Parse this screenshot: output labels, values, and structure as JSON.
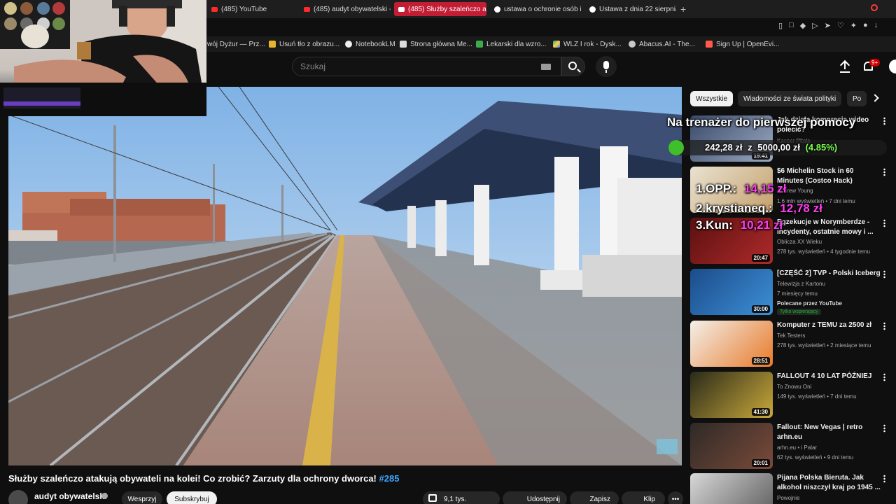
{
  "browser": {
    "tabs": [
      {
        "label": "(485) YouTube",
        "active": false
      },
      {
        "label": "(485) audyt obywatelski -",
        "active": false
      },
      {
        "label": "(485) Służby szaleńczo at",
        "active": true
      },
      {
        "label": "ustawa o ochronie osób i",
        "active": false
      },
      {
        "label": "Ustawa z dnia 22 sierpnia",
        "active": false
      }
    ],
    "new_tab": "+",
    "bookmarks": [
      {
        "label": "wój Dyżur — Prz..."
      },
      {
        "label": "Usuń tło z obrazu..."
      },
      {
        "label": "NotebookLM"
      },
      {
        "label": "Strona główna Me..."
      },
      {
        "label": "Lekarski dla wzro..."
      },
      {
        "label": "WLZ I rok - Dysk..."
      },
      {
        "label": "Abacus.AI - The..."
      },
      {
        "label": "Sign Up | OpenEvi..."
      }
    ]
  },
  "header": {
    "search_placeholder": "Szukaj",
    "notification_count": "9+"
  },
  "video": {
    "title": "Służby szaleńczo atakują obywateli na kolei! Co zrobić? Zarzuty dla ochrony dworca!",
    "hashtag": "#285",
    "channel": "audyt obywatelski",
    "support_label": "Wesprzyj",
    "subscribe_label": "Subskrybuj",
    "likes": "9,1 tys.",
    "share_label": "Udostępnij",
    "save_label": "Zapisz",
    "clip_label": "Klip",
    "more_label": "•••"
  },
  "chips": [
    {
      "label": "Wszystkie",
      "active": true
    },
    {
      "label": "Wiadomości ze świata polityki",
      "active": false
    },
    {
      "label": "Po",
      "active": false
    }
  ],
  "recommendations": [
    {
      "title": "Jak działa kompresja wideo polecić?",
      "channel": "Kacper Pitala",
      "meta": "",
      "extra": "",
      "badge": "",
      "duration": "19:41"
    },
    {
      "title": "$6 Michelin Stock in 60 Minutes (Costco Hack)",
      "channel": "Andrew Young",
      "meta": "1,6 mln wyświetleń • 7 dni temu",
      "extra": "",
      "badge": "",
      "duration": ""
    },
    {
      "title": "Egzekucje w Norymberdze - incydenty, ostatnie mowy i ...",
      "channel": "Oblicza XX Wieku",
      "meta": "278 tys. wyświetleń • 4 tygodnie temu",
      "extra": "",
      "badge": "",
      "duration": "20:47"
    },
    {
      "title": "[CZĘŚĆ 2] TVP - Polski Iceberg",
      "channel": "Telewizja z Kartonu",
      "meta": "7 miesięcy temu",
      "extra": "Polecane przez YouTube",
      "badge": "Tylko wspierający",
      "duration": "30:00"
    },
    {
      "title": "Komputer z TEMU za 2500 zł",
      "channel": "Tek Testers",
      "meta": "278 tys. wyświetleń • 2 miesiące temu",
      "extra": "",
      "badge": "",
      "duration": "28:51"
    },
    {
      "title": "FALLOUT 4 10 LAT PÓŹNIEJ",
      "channel": "To Znowu Oni",
      "meta": "149 tys. wyświetleń • 7 dni temu",
      "extra": "",
      "badge": "",
      "duration": "41:30"
    },
    {
      "title": "Fallout: New Vegas | retro arhn.eu",
      "channel": "arhn.eu • i Palar",
      "meta": "62 tys. wyświetleń • 9 dni temu",
      "extra": "",
      "badge": "",
      "duration": "20:01"
    },
    {
      "title": "Pijana Polska Bieruta. Jak alkohol niszczył kraj po 1945 ...",
      "channel": "Powojnie",
      "meta": "",
      "extra": "",
      "badge": "",
      "duration": ""
    }
  ],
  "overlay": {
    "goal_title": "Na trenażer do pierwszej pomocy",
    "goal_current": "242,28 zł",
    "goal_sep": "z",
    "goal_target": "5000,00 zł",
    "goal_percent": "(4.85%)",
    "goal_fraction": 0.0485,
    "top_donors": [
      {
        "name": "1.OPP.:",
        "amount": "14,15 zł"
      },
      {
        "name": "2.krystianeq.:",
        "amount": "12,78 zł"
      },
      {
        "name": "3.Kun:",
        "amount": "10,21 zł"
      }
    ]
  },
  "colors": {
    "background": "#0f0f0f",
    "accent_tab": "#c21d35",
    "link_blue": "#3ea6ff",
    "goal_green": "#3fbf2a",
    "donor_pink": "#ff3df0"
  }
}
